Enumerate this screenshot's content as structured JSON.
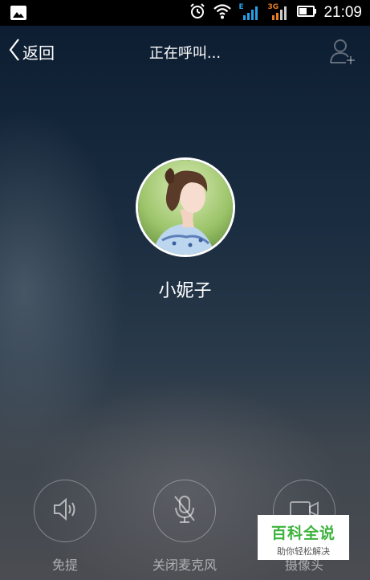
{
  "status_bar": {
    "time": "21:09",
    "icons": [
      "image-icon",
      "alarm-icon",
      "wifi-icon",
      "signal-e-icon",
      "signal-3g-icon",
      "battery-icon"
    ],
    "signal_labels": [
      "E",
      "3G"
    ]
  },
  "header": {
    "back_label": "返回",
    "title": "正在呼叫..."
  },
  "contact": {
    "name": "小妮子"
  },
  "controls": [
    {
      "label": "免提",
      "icon": "speaker-icon"
    },
    {
      "label": "关闭麦克风",
      "icon": "mic-off-icon"
    },
    {
      "label": "摄像头",
      "icon": "camera-icon"
    }
  ],
  "watermark": {
    "main": "百科全说",
    "sub": "助你轻松解决"
  },
  "colors": {
    "background_top": "#0b1b30",
    "background_bottom": "#4a4c51",
    "signal_accent": "#2aa0e6",
    "watermark_green": "#3cb33c"
  }
}
